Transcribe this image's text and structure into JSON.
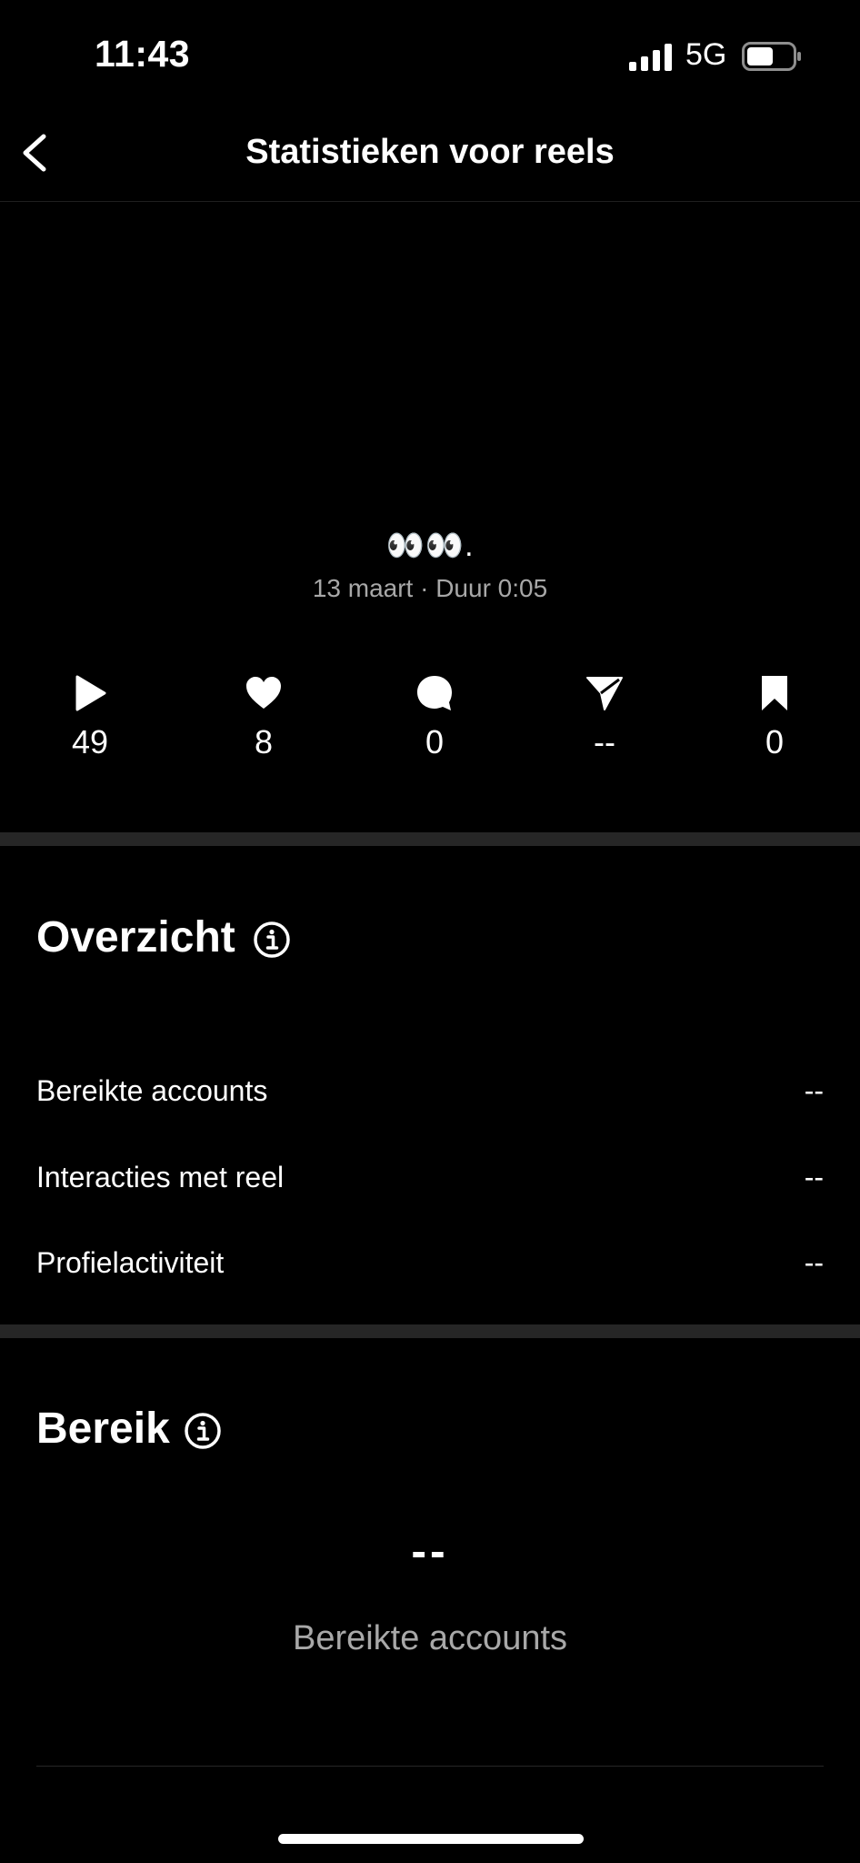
{
  "status_bar": {
    "time": "11:43",
    "network": "5G",
    "icons": [
      "signal-icon",
      "battery-icon"
    ],
    "battery_level": 0.55
  },
  "header": {
    "title": "Statistieken voor reels",
    "back_icon": "chevron-left-icon"
  },
  "reel": {
    "caption": "👀👀.",
    "meta": "13 maart · Duur 0:05"
  },
  "stats": [
    {
      "icon": "play-icon",
      "value": "49"
    },
    {
      "icon": "heart-icon",
      "value": "8"
    },
    {
      "icon": "comment-icon",
      "value": "0"
    },
    {
      "icon": "share-icon",
      "value": "--"
    },
    {
      "icon": "bookmark-icon",
      "value": "0"
    }
  ],
  "overview": {
    "title": "Overzicht",
    "rows": [
      {
        "label": "Bereikte accounts",
        "value": "--"
      },
      {
        "label": "Interacties met reel",
        "value": "--"
      },
      {
        "label": "Profielactiviteit",
        "value": "--"
      }
    ]
  },
  "reach": {
    "title": "Bereik",
    "value": "--",
    "label": "Bereikte accounts"
  },
  "colors": {
    "background": "#000000",
    "text": "#ffffff",
    "secondary_text": "#a8a8a8",
    "separator": "#262626"
  }
}
